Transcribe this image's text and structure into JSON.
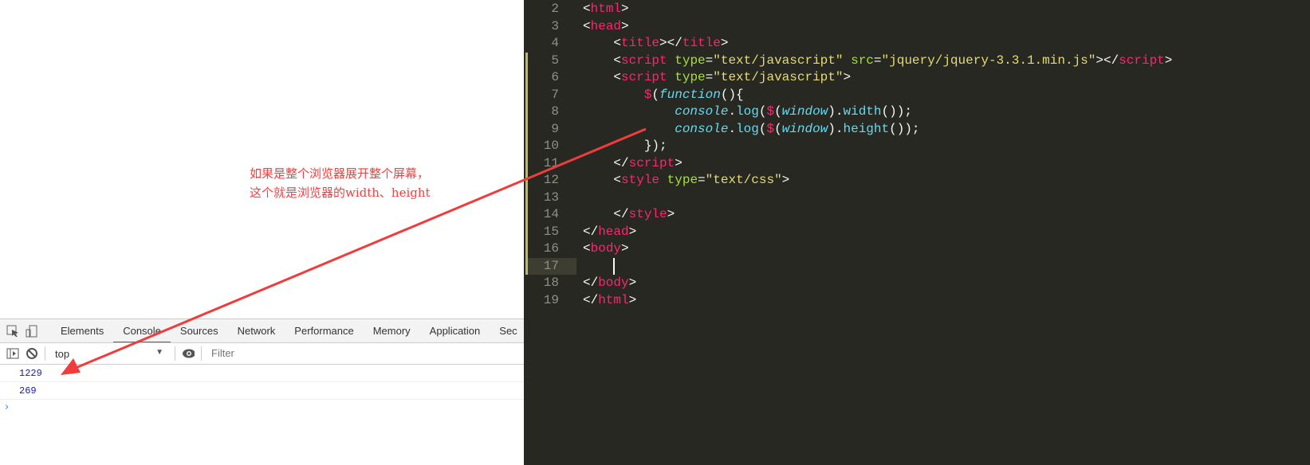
{
  "devtools": {
    "tabs": [
      "Elements",
      "Console",
      "Sources",
      "Network",
      "Performance",
      "Memory",
      "Application",
      "Sec"
    ],
    "active_tab": "Console",
    "context": "top",
    "filter_placeholder": "Filter",
    "messages": [
      "1229",
      "269"
    ],
    "prompt": "›"
  },
  "editor": {
    "lines": [
      {
        "n": "2",
        "tokens": [
          [
            "<",
            "p"
          ],
          [
            "html",
            "t"
          ],
          [
            ">",
            "p"
          ]
        ]
      },
      {
        "n": "3",
        "tokens": [
          [
            "<",
            "p"
          ],
          [
            "head",
            "t"
          ],
          [
            ">",
            "p"
          ]
        ]
      },
      {
        "n": "4",
        "tokens": [
          [
            "    <",
            "p"
          ],
          [
            "title",
            "t"
          ],
          [
            "></",
            "p"
          ],
          [
            "title",
            "t"
          ],
          [
            ">",
            "p"
          ]
        ]
      },
      {
        "n": "5",
        "mod": true,
        "tokens": [
          [
            "    <",
            "p"
          ],
          [
            "script",
            "t"
          ],
          [
            " ",
            "p"
          ],
          [
            "type",
            "a"
          ],
          [
            "=",
            "p"
          ],
          [
            "\"text/javascript\"",
            "s"
          ],
          [
            " ",
            "p"
          ],
          [
            "src",
            "a"
          ],
          [
            "=",
            "p"
          ],
          [
            "\"jquery/jquery-3.3.1.min.js\"",
            "s"
          ],
          [
            "></",
            "p"
          ],
          [
            "script",
            "t"
          ],
          [
            ">",
            "p"
          ]
        ]
      },
      {
        "n": "6",
        "mod": true,
        "tokens": [
          [
            "    <",
            "p"
          ],
          [
            "script",
            "t"
          ],
          [
            " ",
            "p"
          ],
          [
            "type",
            "a"
          ],
          [
            "=",
            "p"
          ],
          [
            "\"text/javascript\"",
            "s"
          ],
          [
            ">",
            "p"
          ]
        ]
      },
      {
        "n": "7",
        "mod": true,
        "tokens": [
          [
            "        ",
            "p"
          ],
          [
            "$",
            "t"
          ],
          [
            "(",
            "p"
          ],
          [
            "function",
            "f"
          ],
          [
            "(){",
            "p"
          ]
        ]
      },
      {
        "n": "8",
        "mod": true,
        "tokens": [
          [
            "            ",
            "p"
          ],
          [
            "console",
            "f"
          ],
          [
            ".",
            "p"
          ],
          [
            "log",
            "k"
          ],
          [
            "(",
            "p"
          ],
          [
            "$",
            "t"
          ],
          [
            "(",
            "p"
          ],
          [
            "window",
            "f"
          ],
          [
            ").",
            "p"
          ],
          [
            "width",
            "k"
          ],
          [
            "());",
            "p"
          ]
        ]
      },
      {
        "n": "9",
        "mod": true,
        "tokens": [
          [
            "            ",
            "p"
          ],
          [
            "console",
            "f"
          ],
          [
            ".",
            "p"
          ],
          [
            "log",
            "k"
          ],
          [
            "(",
            "p"
          ],
          [
            "$",
            "t"
          ],
          [
            "(",
            "p"
          ],
          [
            "window",
            "f"
          ],
          [
            ").",
            "p"
          ],
          [
            "height",
            "k"
          ],
          [
            "());",
            "p"
          ]
        ]
      },
      {
        "n": "10",
        "mod": true,
        "tokens": [
          [
            "        });",
            "p"
          ]
        ]
      },
      {
        "n": "11",
        "mod": true,
        "tokens": [
          [
            "    </",
            "p"
          ],
          [
            "script",
            "t"
          ],
          [
            ">",
            "p"
          ]
        ]
      },
      {
        "n": "12",
        "mod": true,
        "tokens": [
          [
            "    <",
            "p"
          ],
          [
            "style",
            "t"
          ],
          [
            " ",
            "p"
          ],
          [
            "type",
            "a"
          ],
          [
            "=",
            "p"
          ],
          [
            "\"text/css\"",
            "s"
          ],
          [
            ">",
            "p"
          ]
        ]
      },
      {
        "n": "13",
        "mod": true,
        "tokens": []
      },
      {
        "n": "14",
        "mod": true,
        "tokens": [
          [
            "    </",
            "p"
          ],
          [
            "style",
            "t"
          ],
          [
            ">",
            "p"
          ]
        ]
      },
      {
        "n": "15",
        "mod": true,
        "tokens": [
          [
            "</",
            "p"
          ],
          [
            "head",
            "t"
          ],
          [
            ">",
            "p"
          ]
        ]
      },
      {
        "n": "16",
        "mod": true,
        "tokens": [
          [
            "<",
            "p"
          ],
          [
            "body",
            "t"
          ],
          [
            ">",
            "p"
          ]
        ]
      },
      {
        "n": "17",
        "mod": true,
        "current": true,
        "tokens": [
          [
            "    ",
            "p"
          ]
        ]
      },
      {
        "n": "18",
        "tokens": [
          [
            "</",
            "p"
          ],
          [
            "body",
            "t"
          ],
          [
            ">",
            "p"
          ]
        ]
      },
      {
        "n": "19",
        "tokens": [
          [
            "</",
            "p"
          ],
          [
            "html",
            "t"
          ],
          [
            ">",
            "p"
          ]
        ]
      }
    ]
  },
  "annotation": {
    "line1": "如果是整个浏览器展开整个屏幕，",
    "line2": "这个就是浏览器的width、height",
    "color": "#ff3b3b"
  },
  "icons": [
    "inspect-icon",
    "device-toggle-icon",
    "sidebar-toggle-icon",
    "clear-console-icon",
    "eye-icon",
    "dropdown-arrow-icon"
  ]
}
